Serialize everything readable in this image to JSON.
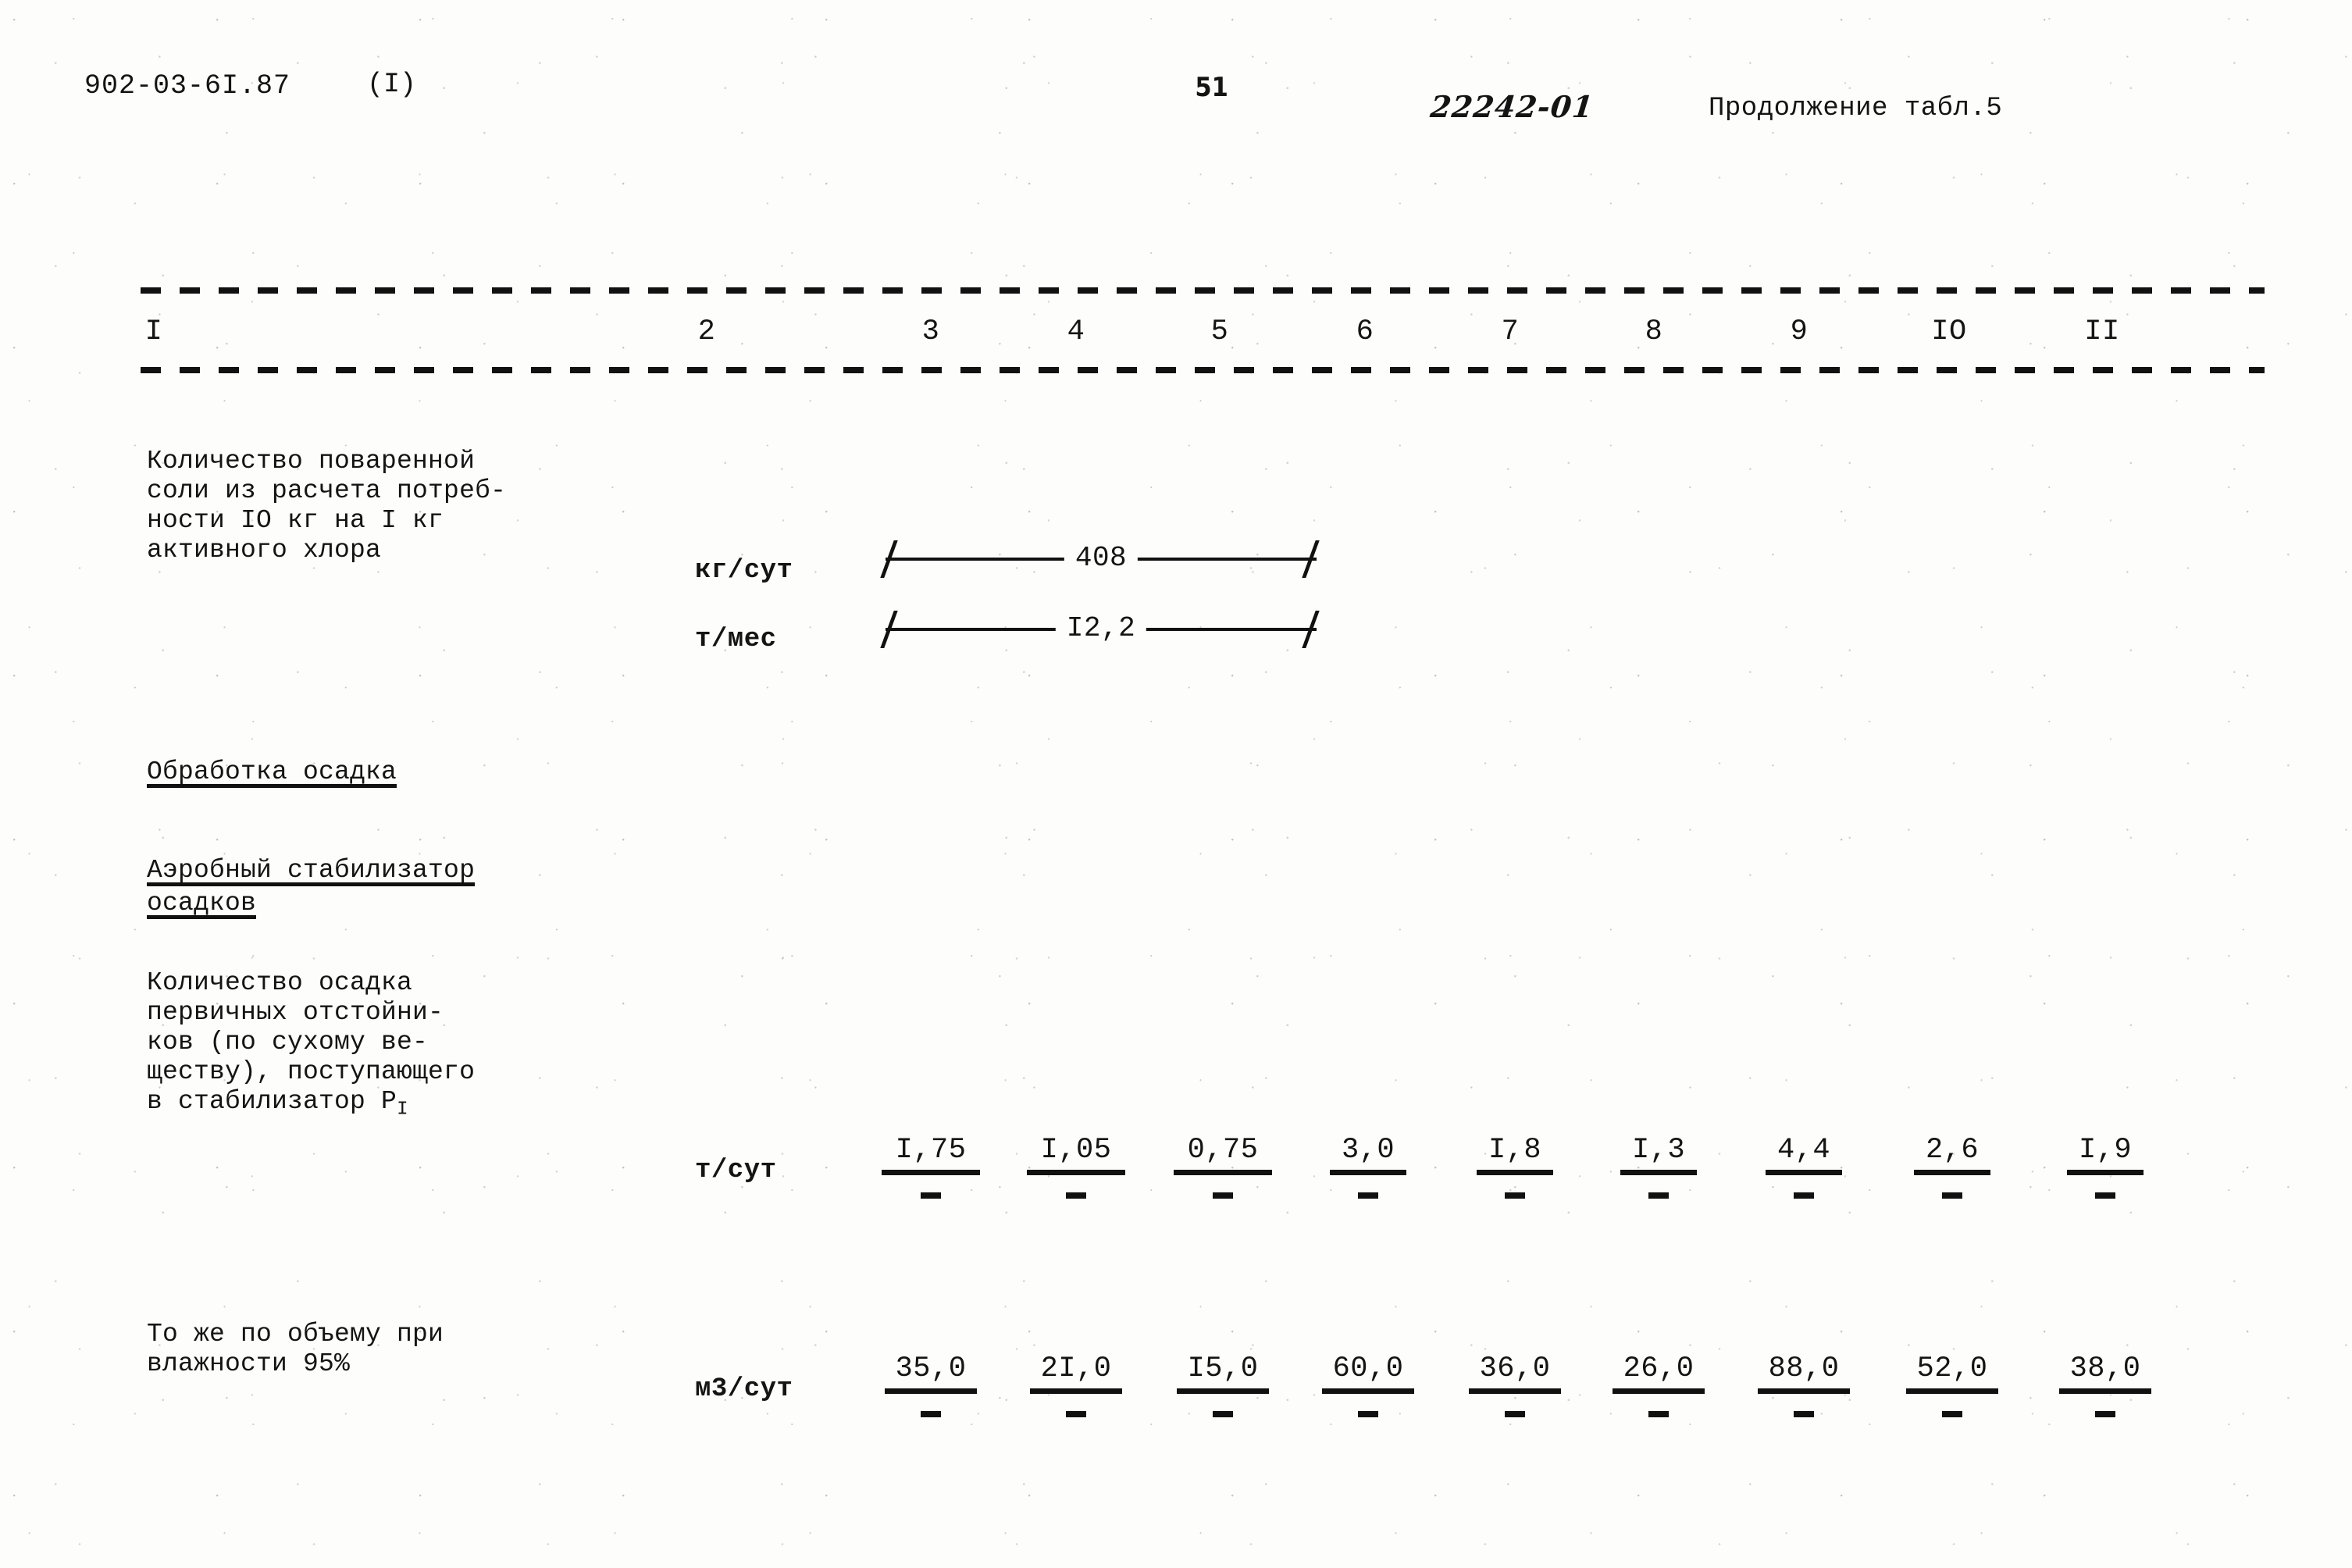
{
  "header": {
    "doc_code": "902-03-6I.87",
    "doc_variant": "(I)",
    "page_number": "51",
    "stamp": "22242-01",
    "table_continuation": "Продолжение табл.5"
  },
  "table": {
    "column_headers": [
      "I",
      "2",
      "3",
      "4",
      "5",
      "6",
      "7",
      "8",
      "9",
      "IO",
      "II"
    ],
    "rows": [
      {
        "name": "salt-quantity",
        "stub": "Количество поваренной\nсоли из расчета потреб-\nности IO кг на I кг\nактивного хлора",
        "measures": [
          {
            "unit": "кг/сут",
            "span_value": "408"
          },
          {
            "unit": "т/мес",
            "span_value": "I2,2"
          }
        ]
      },
      {
        "name": "sludge-treatment-heading",
        "heading": "Обработка осадка"
      },
      {
        "name": "aerobic-stabilizer-heading",
        "heading": "Аэробный стабилизатор\nосадков"
      },
      {
        "name": "primary-sludge-quantity",
        "stub": "Количество осадка\nпервичных отстойни-\nков (по сухому ве-\nществу), поступающего\nв стабилизатор Р",
        "stub_subscript": "I",
        "unit": "т/сут",
        "values": [
          "I,75",
          "I,05",
          "0,75",
          "3,0",
          "I,8",
          "I,3",
          "4,4",
          "2,6",
          "I,9"
        ],
        "denominators": [
          "-",
          "-",
          "-",
          "-",
          "-",
          "-",
          "-",
          "-",
          "-"
        ]
      },
      {
        "name": "sludge-volume-95",
        "stub": "То же по объему при\nвлажности 95%",
        "unit": "м3/сут",
        "values": [
          "35,0",
          "2I,0",
          "I5,0",
          "60,0",
          "36,0",
          "26,0",
          "88,0",
          "52,0",
          "38,0"
        ],
        "denominators": [
          "-",
          "-",
          "-",
          "-",
          "-",
          "-",
          "-",
          "-",
          "-"
        ]
      }
    ]
  }
}
